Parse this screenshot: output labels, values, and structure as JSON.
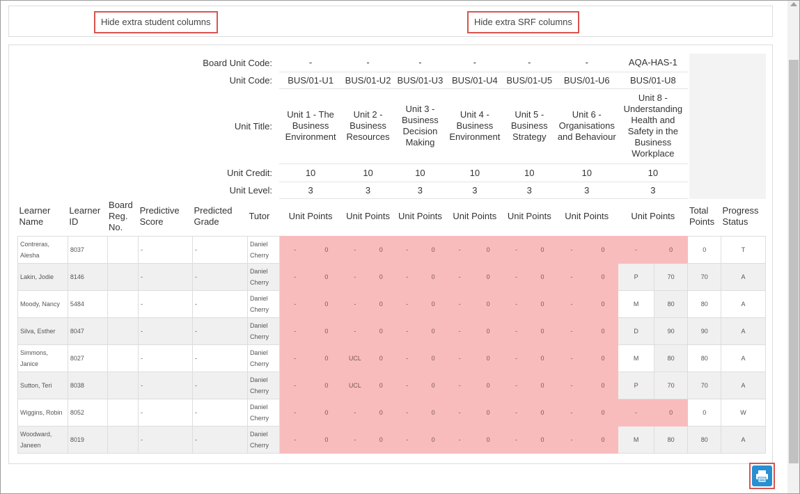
{
  "toolbar": {
    "hide_student_label": "Hide extra student columns",
    "hide_srf_label": "Hide extra SRF columns"
  },
  "header_labels": {
    "board_unit_code": "Board Unit Code:",
    "unit_code": "Unit Code:",
    "unit_title": "Unit Title:",
    "unit_credit": "Unit Credit:",
    "unit_level": "Unit Level:"
  },
  "units": [
    {
      "board_code": "-",
      "code": "BUS/01-U1",
      "title": "Unit 1 - The Business Environment",
      "credit": "10",
      "level": "3",
      "points_label": "Unit Points"
    },
    {
      "board_code": "-",
      "code": "BUS/01-U2",
      "title": "Unit 2 - Business Resources",
      "credit": "10",
      "level": "3",
      "points_label": "Unit Points"
    },
    {
      "board_code": "-",
      "code": "BUS/01-U3",
      "title": "Unit 3 - Business Decision Making",
      "credit": "10",
      "level": "3",
      "points_label": "Unit Points"
    },
    {
      "board_code": "-",
      "code": "BUS/01-U4",
      "title": "Unit 4 - Business Environment",
      "credit": "10",
      "level": "3",
      "points_label": "Unit Points"
    },
    {
      "board_code": "-",
      "code": "BUS/01-U5",
      "title": "Unit 5 - Business Strategy",
      "credit": "10",
      "level": "3",
      "points_label": "Unit Points"
    },
    {
      "board_code": "-",
      "code": "BUS/01-U6",
      "title": "Unit 6 - Organisations and Behaviour",
      "credit": "10",
      "level": "3",
      "points_label": "Unit Points"
    },
    {
      "board_code": "AQA-HAS-1",
      "code": "BUS/01-U8",
      "title": "Unit 8 - Understanding Health and Safety in the Business Workplace",
      "credit": "10",
      "level": "3",
      "points_label": "Unit Points"
    }
  ],
  "columns": {
    "learner_name": "Learner Name",
    "learner_id": "Learner ID",
    "board_reg": "Board Reg. No.",
    "predictive_score": "Predictive Score",
    "predicted_grade": "Predicted Grade",
    "tutor": "Tutor",
    "total_points": "Total Points",
    "progress_status": "Progress Status"
  },
  "learners": [
    {
      "name": "Contreras, Alesha",
      "id": "8037",
      "reg": "",
      "score": "-",
      "grade": "-",
      "tutor": "Daniel Cherry",
      "units": [
        [
          "-",
          "0"
        ],
        [
          "-",
          "0"
        ],
        [
          "-",
          "0"
        ],
        [
          "-",
          "0"
        ],
        [
          "-",
          "0"
        ],
        [
          "-",
          "0"
        ],
        [
          "-",
          "0"
        ]
      ],
      "u8_pink": true,
      "total": "0",
      "status": "T"
    },
    {
      "name": "Lakin, Jodie",
      "id": "8146",
      "reg": "",
      "score": "-",
      "grade": "-",
      "tutor": "Daniel Cherry",
      "units": [
        [
          "-",
          "0"
        ],
        [
          "-",
          "0"
        ],
        [
          "-",
          "0"
        ],
        [
          "-",
          "0"
        ],
        [
          "-",
          "0"
        ],
        [
          "-",
          "0"
        ],
        [
          "P",
          "70"
        ]
      ],
      "u8_pink": false,
      "total": "70",
      "status": "A"
    },
    {
      "name": "Moody, Nancy",
      "id": "5484",
      "reg": "",
      "score": "-",
      "grade": "-",
      "tutor": "Daniel Cherry",
      "units": [
        [
          "-",
          "0"
        ],
        [
          "-",
          "0"
        ],
        [
          "-",
          "0"
        ],
        [
          "-",
          "0"
        ],
        [
          "-",
          "0"
        ],
        [
          "-",
          "0"
        ],
        [
          "M",
          "80"
        ]
      ],
      "u8_pink": false,
      "total": "80",
      "status": "A"
    },
    {
      "name": "Silva, Esther",
      "id": "8047",
      "reg": "",
      "score": "-",
      "grade": "-",
      "tutor": "Daniel Cherry",
      "units": [
        [
          "-",
          "0"
        ],
        [
          "-",
          "0"
        ],
        [
          "-",
          "0"
        ],
        [
          "-",
          "0"
        ],
        [
          "-",
          "0"
        ],
        [
          "-",
          "0"
        ],
        [
          "D",
          "90"
        ]
      ],
      "u8_pink": false,
      "total": "90",
      "status": "A"
    },
    {
      "name": "Simmons, Janice",
      "id": "8027",
      "reg": "",
      "score": "-",
      "grade": "-",
      "tutor": "Daniel Cherry",
      "units": [
        [
          "-",
          "0"
        ],
        [
          "UCL",
          "0"
        ],
        [
          "-",
          "0"
        ],
        [
          "-",
          "0"
        ],
        [
          "-",
          "0"
        ],
        [
          "-",
          "0"
        ],
        [
          "M",
          "80"
        ]
      ],
      "u8_pink": false,
      "total": "80",
      "status": "A"
    },
    {
      "name": "Sutton, Teri",
      "id": "8038",
      "reg": "",
      "score": "-",
      "grade": "-",
      "tutor": "Daniel Cherry",
      "units": [
        [
          "-",
          "0"
        ],
        [
          "UCL",
          "0"
        ],
        [
          "-",
          "0"
        ],
        [
          "-",
          "0"
        ],
        [
          "-",
          "0"
        ],
        [
          "-",
          "0"
        ],
        [
          "P",
          "70"
        ]
      ],
      "u8_pink": false,
      "total": "70",
      "status": "A"
    },
    {
      "name": "Wiggins, Robin",
      "id": "8052",
      "reg": "",
      "score": "-",
      "grade": "-",
      "tutor": "Daniel Cherry",
      "units": [
        [
          "-",
          "0"
        ],
        [
          "-",
          "0"
        ],
        [
          "-",
          "0"
        ],
        [
          "-",
          "0"
        ],
        [
          "-",
          "0"
        ],
        [
          "-",
          "0"
        ],
        [
          "-",
          "0"
        ]
      ],
      "u8_pink": true,
      "total": "0",
      "status": "W"
    },
    {
      "name": "Woodward, Janeen",
      "id": "8019",
      "reg": "",
      "score": "-",
      "grade": "-",
      "tutor": "Daniel Cherry",
      "units": [
        [
          "-",
          "0"
        ],
        [
          "-",
          "0"
        ],
        [
          "-",
          "0"
        ],
        [
          "-",
          "0"
        ],
        [
          "-",
          "0"
        ],
        [
          "-",
          "0"
        ],
        [
          "M",
          "80"
        ]
      ],
      "u8_pink": false,
      "total": "80",
      "status": "A"
    }
  ],
  "icons": {
    "print": "print-icon"
  },
  "colors": {
    "highlight_border": "#d9534f",
    "fail_cell": "#f9bcbc",
    "print_button": "#2a8fd0"
  }
}
